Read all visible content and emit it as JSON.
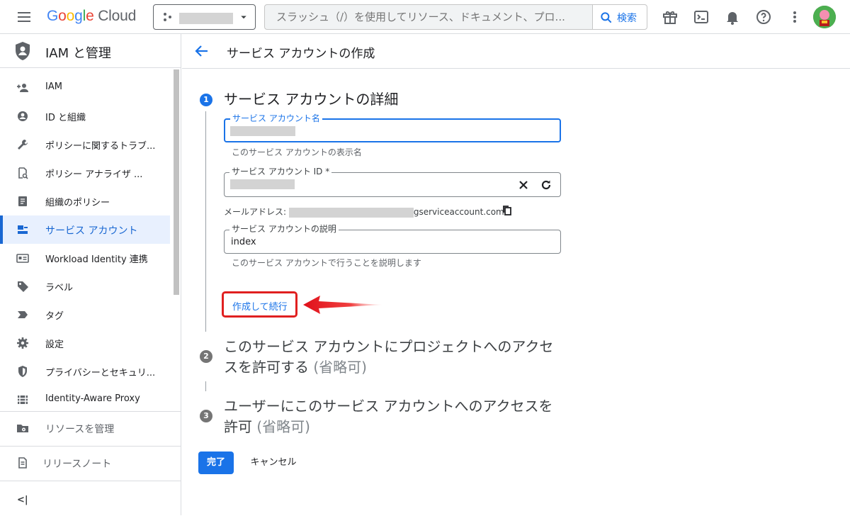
{
  "topbar": {
    "logo_google": "Google",
    "logo_cloud": "Cloud",
    "search_placeholder": "スラッシュ（/）を使用してリソース、ドキュメント、プロ...",
    "search_button": "検索"
  },
  "sidebar": {
    "title": "IAM と管理",
    "items": [
      {
        "label": "IAM",
        "icon": "person-add-icon"
      },
      {
        "label": "ID と組織",
        "icon": "account-circle-icon"
      },
      {
        "label": "ポリシーに関するトラブ...",
        "icon": "wrench-icon"
      },
      {
        "label": "ポリシー アナライザ ...",
        "icon": "policy-analyzer-icon"
      },
      {
        "label": "組織のポリシー",
        "icon": "document-icon"
      },
      {
        "label": "サービス アカウント",
        "icon": "service-account-icon",
        "active": true
      },
      {
        "label": "Workload Identity 連携",
        "icon": "id-card-icon"
      },
      {
        "label": "ラベル",
        "icon": "label-icon"
      },
      {
        "label": "タグ",
        "icon": "tag-icon"
      },
      {
        "label": "設定",
        "icon": "gear-icon"
      },
      {
        "label": "プライバシーとセキュリ...",
        "icon": "shield-icon"
      },
      {
        "label": "Identity-Aware Proxy",
        "icon": "proxy-icon"
      }
    ],
    "manage_resources": "リソースを管理",
    "release_notes": "リリースノート",
    "collapse": "<|"
  },
  "page": {
    "title": "サービス アカウントの作成",
    "step1": {
      "number": "1",
      "title": "サービス アカウントの詳細",
      "name_label": "サービス アカウント名",
      "name_hint": "このサービス アカウントの表示名",
      "id_label": "サービス アカウント ID *",
      "email_prefix": "メールアドレス:",
      "email_suffix": "gserviceaccount.com",
      "desc_label": "サービス アカウントの説明",
      "desc_value": "index",
      "desc_hint": "このサービス アカウントで行うことを説明します",
      "create_button": "作成して続行"
    },
    "step2": {
      "number": "2",
      "title_line1": "このサービス アカウントにプロジェクトへのアクセ",
      "title_line2": "スを許可する",
      "optional": "(省略可)"
    },
    "step3": {
      "number": "3",
      "title_line1": "ユーザーにこのサービス アカウントへのアクセスを",
      "title_line2": "許可",
      "optional": "(省略可)"
    },
    "done_button": "完了",
    "cancel_button": "キャンセル"
  },
  "colors": {
    "accent": "#1a73e8",
    "highlight_red": "#e02020"
  }
}
